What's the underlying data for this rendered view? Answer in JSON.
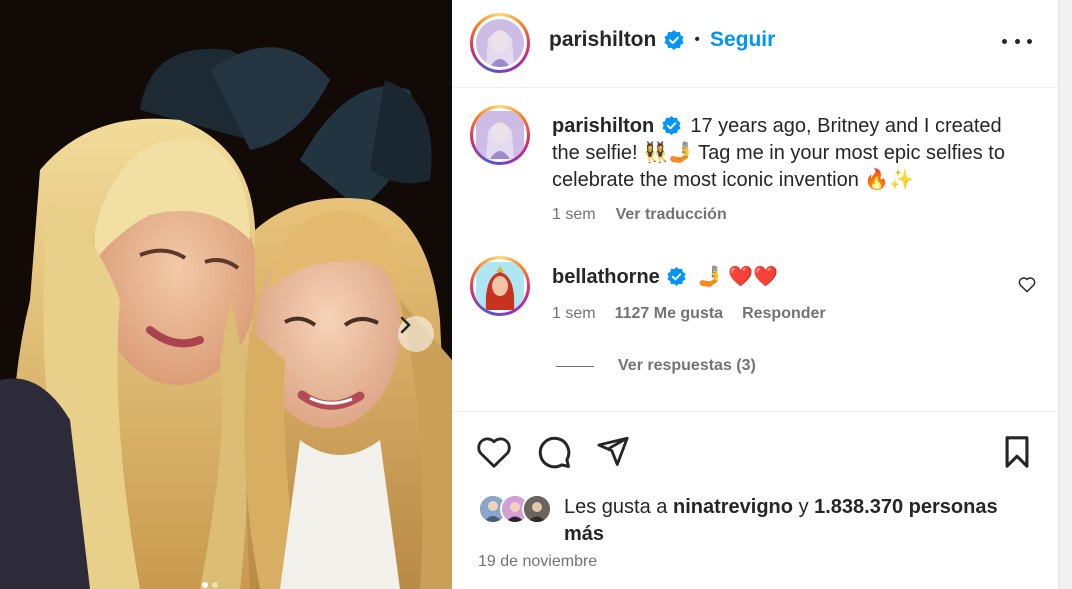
{
  "header": {
    "username": "parishilton",
    "separator": "•",
    "follow_label": "Seguir"
  },
  "caption": {
    "username": "parishilton",
    "text": "17 years ago, Britney and I created the selfie! 👯‍♀️🤳 Tag me in your most epic selfies to celebrate the most iconic invention 🔥✨",
    "time": "1 sem",
    "translate_label": "Ver traducción"
  },
  "comment": {
    "username": "bellathorne",
    "text": "🤳 ❤️❤️",
    "time": "1 sem",
    "likes": "1127 Me gusta",
    "reply_label": "Responder",
    "view_replies_label": "Ver respuestas (3)"
  },
  "likes": {
    "prefix": "Les gusta a",
    "user": "ninatrevigno",
    "connector": "y",
    "count": "1.838.370",
    "suffix": "personas más"
  },
  "date": "19 de noviembre",
  "colors": {
    "accent": "#0095f6",
    "text": "#262626",
    "secondary": "#737373",
    "verified": "#0095f6"
  },
  "icons": {
    "like": "heart-icon",
    "comment": "comment-icon",
    "share": "send-icon",
    "save": "bookmark-icon",
    "more": "more-horizontal-icon",
    "next": "chevron-right-icon"
  }
}
